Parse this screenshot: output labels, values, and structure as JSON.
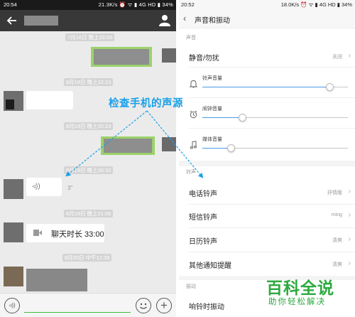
{
  "left_status": {
    "time": "20:54",
    "right": "21.3K/s ⏰ ᯤ ▮ 4G HD ▮ 34%"
  },
  "right_status": {
    "time": "20:52",
    "right": "18.0K/s ⏰ ᯤ ▮ 4G HD ▮ 34%"
  },
  "chat": {
    "timestamps": [
      "7月16日 晚上22:00",
      "8月18日 晚上22:23",
      "8月19日 晚上20:23",
      "8月19日 晚上20:32",
      "8月19日 晚上21:05",
      "8月20日 中午12:39"
    ],
    "voice_duration": "3\"",
    "call_text": "聊天时长 33:00"
  },
  "annotation": {
    "text": "检查手机的声源",
    "color": "#1aa0e8"
  },
  "settings": {
    "title": "声音和振动",
    "section_sound": "声音",
    "dnd": {
      "label": "静音/勿扰",
      "value": "关闭"
    },
    "sliders": [
      {
        "label": "铃声音量",
        "icon": "bell-icon",
        "level": 0.88
      },
      {
        "label": "闹钟音量",
        "icon": "alarm-clock-icon",
        "level": 0.28
      },
      {
        "label": "媒体音量",
        "icon": "music-note-icon",
        "level": 0.2
      }
    ],
    "section_ringtone": "铃声",
    "ringtones": [
      {
        "label": "电话铃声",
        "value": "抒情版"
      },
      {
        "label": "短信铃声",
        "value": "ming"
      },
      {
        "label": "日历铃声",
        "value": "清爽"
      },
      {
        "label": "其他通知提醒",
        "value": "清爽"
      }
    ],
    "section_vibrate": "振动",
    "vibrate_row": {
      "label": "响铃时振动"
    }
  },
  "watermark": {
    "main": "百科全说",
    "sub": "助你轻松解决",
    "color": "#2daa3f"
  }
}
